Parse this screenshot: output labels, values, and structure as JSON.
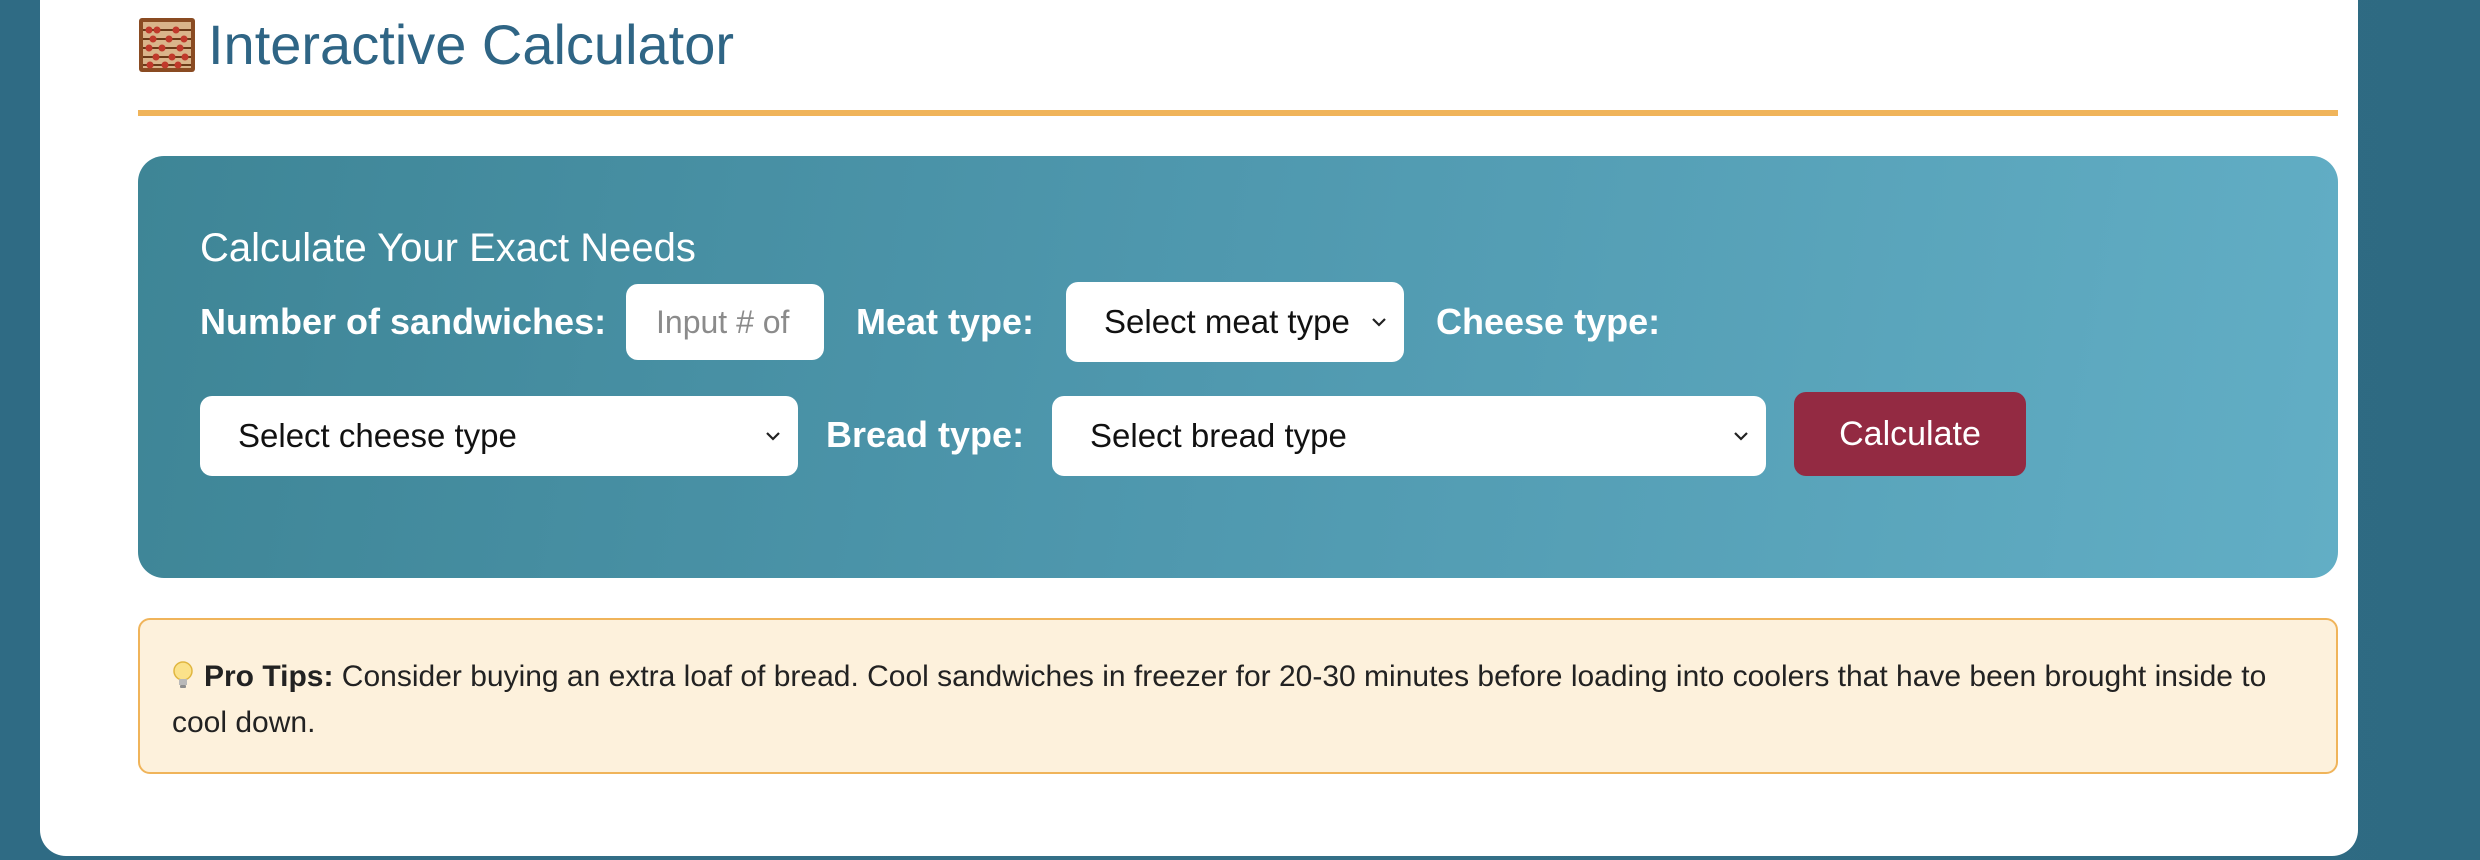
{
  "header": {
    "title": "Interactive Calculator",
    "icon": "abacus-icon"
  },
  "calculator": {
    "heading": "Calculate Your Exact Needs",
    "sandwiches": {
      "label": "Number of sandwiches:",
      "placeholder": "Input # of",
      "value": ""
    },
    "meat": {
      "label": "Meat type:",
      "selected": "Select meat type"
    },
    "cheese": {
      "label": "Cheese type:",
      "selected": "Select cheese type"
    },
    "bread": {
      "label": "Bread type:",
      "selected": "Select bread type"
    },
    "calculate_label": "Calculate"
  },
  "tips": {
    "icon": "lightbulb-icon",
    "label": "Pro Tips:",
    "text": " Consider buying an extra loaf of bread. Cool sandwiches in freezer for 20-30 minutes before loading into coolers that have been brought inside to cool down."
  },
  "colors": {
    "title": "#2f6585",
    "accent_rule": "#f0b45a",
    "panel": "#4e97ad",
    "button": "#932a42",
    "tips_bg": "#fdf1dc"
  }
}
